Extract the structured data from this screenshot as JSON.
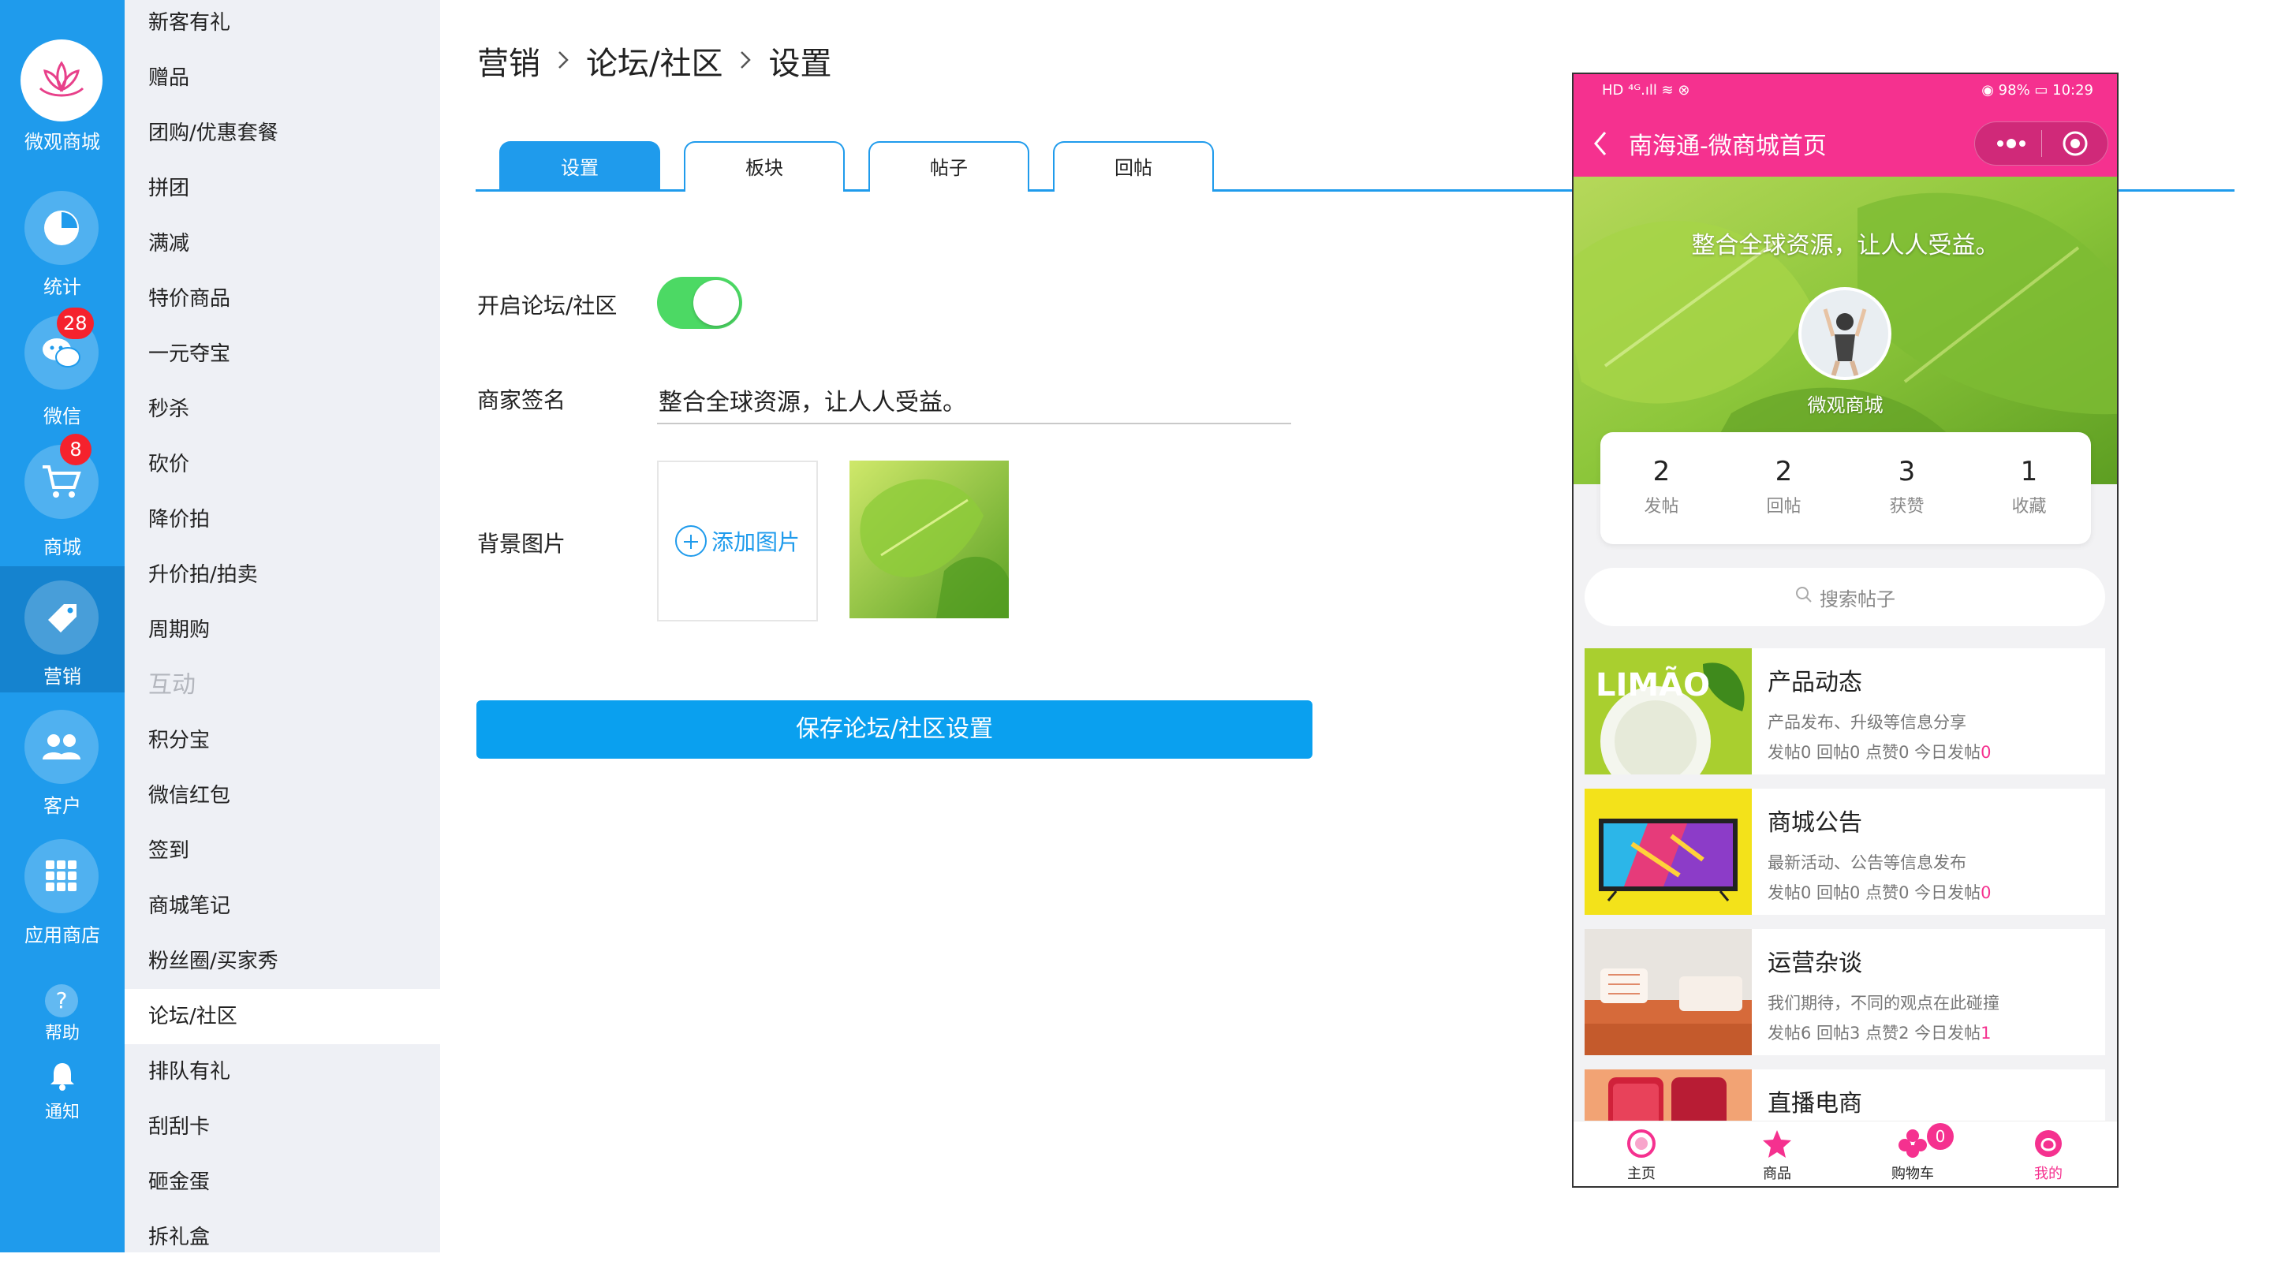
{
  "rail": {
    "logo_label": "微观商城",
    "items": [
      {
        "label": "统计",
        "icon": "pie-chart-icon"
      },
      {
        "label": "微信",
        "icon": "wechat-icon",
        "badge": "28"
      },
      {
        "label": "商城",
        "icon": "cart-icon",
        "badge": "8"
      },
      {
        "label": "营销",
        "icon": "tag-icon"
      },
      {
        "label": "客户",
        "icon": "users-icon"
      },
      {
        "label": "应用商店",
        "icon": "apps-grid-icon"
      },
      {
        "label": "帮助",
        "icon": "help-icon"
      },
      {
        "label": "通知",
        "icon": "bell-icon"
      }
    ]
  },
  "submenu": {
    "items": [
      "新客有礼",
      "赠品",
      "团购/优惠套餐",
      "拼团",
      "满减",
      "特价商品",
      "一元夺宝",
      "秒杀",
      "砍价",
      "降价拍",
      "升价拍/拍卖",
      "周期购"
    ],
    "group_label": "互动",
    "items2": [
      "积分宝",
      "微信红包",
      "签到",
      "商城笔记",
      "粉丝圈/买家秀",
      "论坛/社区",
      "排队有礼",
      "刮刮卡",
      "砸金蛋",
      "拆礼盒"
    ]
  },
  "breadcrumb": [
    "营销",
    "论坛/社区",
    "设置"
  ],
  "tabs": [
    "设置",
    "板块",
    "帖子",
    "回帖"
  ],
  "form": {
    "enable_label": "开启论坛/社区",
    "enable_on": true,
    "signature_label": "商家签名",
    "signature_value": "整合全球资源，让人人受益。",
    "bg_label": "背景图片",
    "add_image_label": "添加图片",
    "save_label": "保存论坛/社区设置"
  },
  "phone": {
    "status_left": "HD ⁴ᴳ.ıll ≋ ⊗",
    "status_right": "◉ 98% ▭ 10:29",
    "title": "南海通-微商城首页",
    "hero_text": "整合全球资源，让人人受益。",
    "shop_name": "微观商城",
    "stats": [
      {
        "num": "2",
        "label": "发帖"
      },
      {
        "num": "2",
        "label": "回帖"
      },
      {
        "num": "3",
        "label": "获赞"
      },
      {
        "num": "1",
        "label": "收藏"
      }
    ],
    "search_placeholder": "搜索帖子",
    "boards": [
      {
        "title": "产品动态",
        "desc": "产品发布、升级等信息分享",
        "stats": "发帖0 回帖0 点赞0 今日发帖",
        "today": "0",
        "img_text": "LIMÃO"
      },
      {
        "title": "商城公告",
        "desc": "最新活动、公告等信息发布",
        "stats": "发帖0 回帖0 点赞0 今日发帖",
        "today": "0"
      },
      {
        "title": "运营杂谈",
        "desc": "我们期待，不同的观点在此碰撞",
        "stats": "发帖6 回帖3 点赞2 今日发帖",
        "today": "1"
      },
      {
        "title": "直播电商",
        "desc": "",
        "stats": "",
        "today": ""
      }
    ],
    "tabbar": [
      {
        "label": "主页",
        "icon": "home-icon"
      },
      {
        "label": "商品",
        "icon": "goods-icon"
      },
      {
        "label": "购物车",
        "icon": "cart-icon",
        "badge": "0"
      },
      {
        "label": "我的",
        "icon": "me-icon"
      }
    ]
  },
  "colors": {
    "accent": "#1f9bec",
    "pink": "#f5318f",
    "toggle_on": "#4cd964"
  }
}
